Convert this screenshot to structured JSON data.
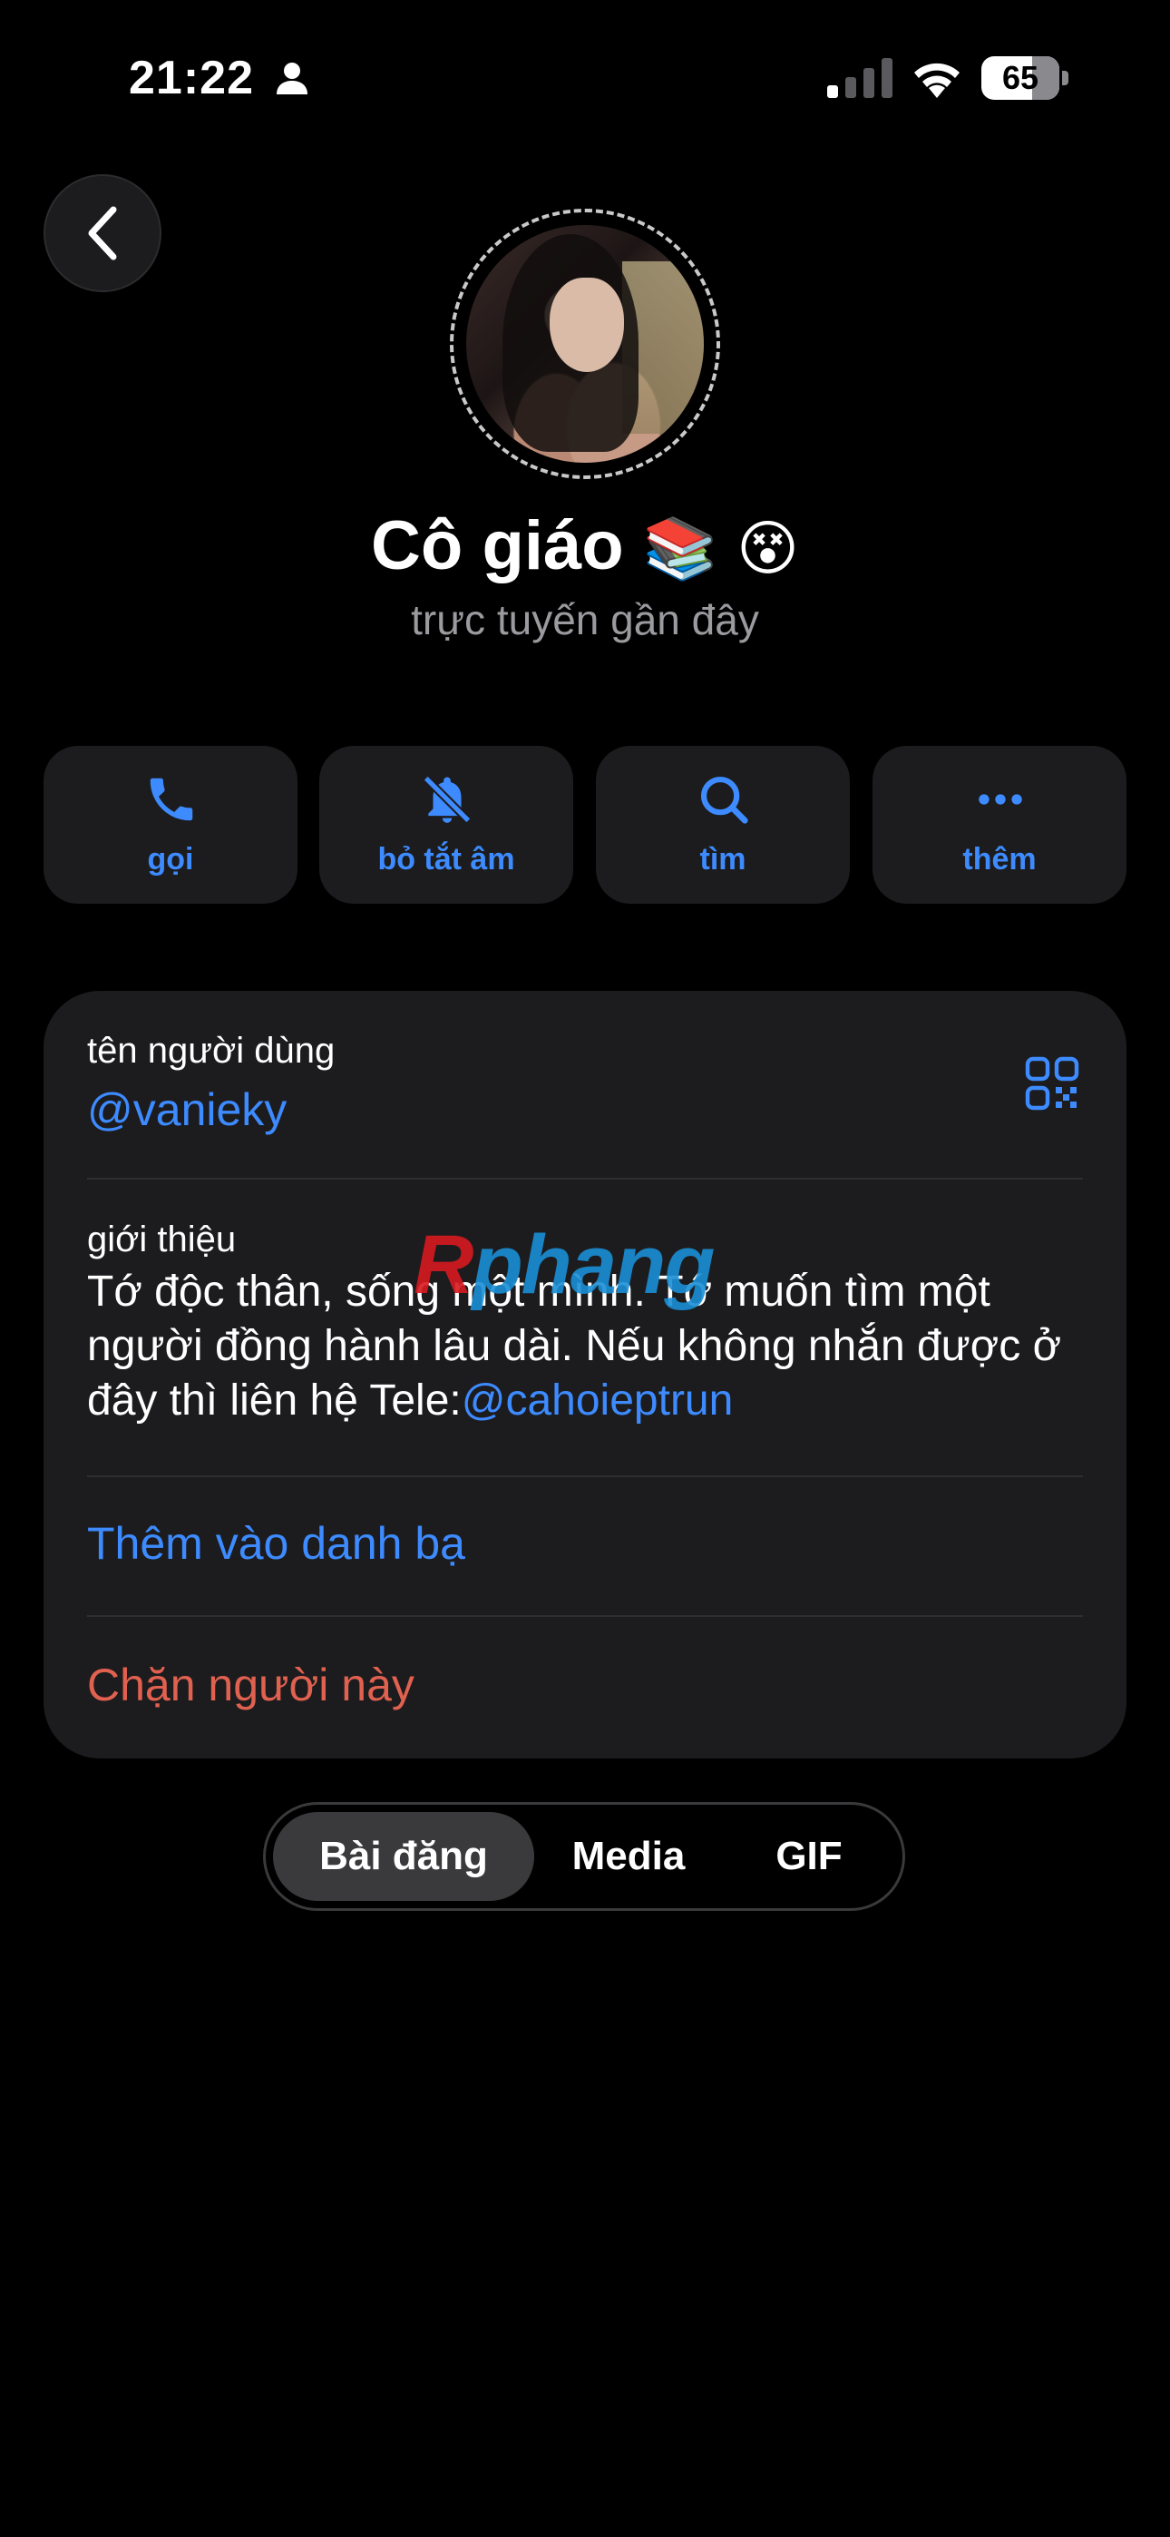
{
  "status_bar": {
    "time": "21:22",
    "battery": "65"
  },
  "profile": {
    "name": "Cô giáo",
    "name_emojis": [
      "📚",
      "😵"
    ],
    "status": "trực tuyến gần đây"
  },
  "actions": [
    {
      "label": "gọi",
      "icon": "phone-icon"
    },
    {
      "label": "bỏ tắt âm",
      "icon": "bell-slash-icon"
    },
    {
      "label": "tìm",
      "icon": "search-icon"
    },
    {
      "label": "thêm",
      "icon": "ellipsis-icon"
    }
  ],
  "info": {
    "username_label": "tên người dùng",
    "username": "@vanieky",
    "bio_label": "giới thiệu",
    "bio_text": "Tớ độc thân, sống một mình. Tớ muốn tìm một người đồng hành lâu dài. Nếu không nhắn được ở đây thì liên hệ Tele:",
    "bio_mention": "@cahoieptrun",
    "add_contact": "Thêm vào danh bạ",
    "block": "Chặn người này"
  },
  "watermark": {
    "first": "R",
    "rest": "phang"
  },
  "tabs": [
    {
      "label": "Bài đăng",
      "active": true
    },
    {
      "label": "Media",
      "active": false
    },
    {
      "label": "GIF",
      "active": false
    }
  ],
  "colors": {
    "accent": "#3d8bff",
    "danger": "#e0614f",
    "card": "#1c1c1e"
  }
}
